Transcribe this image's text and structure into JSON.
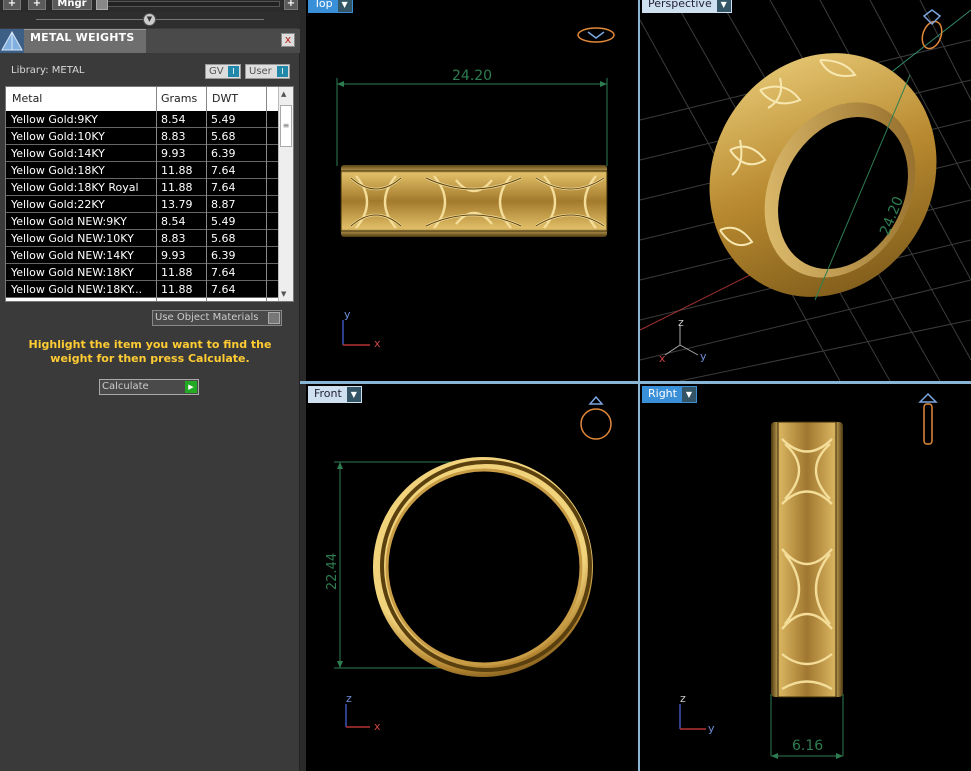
{
  "toolbar": {
    "btn_plus_1": "+",
    "btn_plus_2": "+",
    "btn_mngr": "Mngr",
    "btn_plus_3": "+"
  },
  "panel": {
    "title": "METAL WEIGHTS",
    "close": "x",
    "library_label": "Library: METAL",
    "gv_label": "GV",
    "user_label": "User",
    "columns": [
      "Metal",
      "Grams",
      "DWT"
    ],
    "rows": [
      {
        "metal": "Yellow Gold:9KY",
        "grams": "8.54",
        "dwt": "5.49"
      },
      {
        "metal": "Yellow Gold:10KY",
        "grams": "8.83",
        "dwt": "5.68"
      },
      {
        "metal": "Yellow Gold:14KY",
        "grams": "9.93",
        "dwt": "6.39"
      },
      {
        "metal": "Yellow Gold:18KY",
        "grams": "11.88",
        "dwt": "7.64"
      },
      {
        "metal": "Yellow Gold:18KY Royal",
        "grams": "11.88",
        "dwt": "7.64"
      },
      {
        "metal": "Yellow Gold:22KY",
        "grams": "13.79",
        "dwt": "8.87"
      },
      {
        "metal": "Yellow Gold NEW:9KY",
        "grams": "8.54",
        "dwt": "5.49"
      },
      {
        "metal": "Yellow Gold NEW:10KY",
        "grams": "8.83",
        "dwt": "5.68"
      },
      {
        "metal": "Yellow Gold NEW:14KY",
        "grams": "9.93",
        "dwt": "6.39"
      },
      {
        "metal": "Yellow Gold NEW:18KY",
        "grams": "11.88",
        "dwt": "7.64"
      },
      {
        "metal": "Yellow Gold NEW:18KY...",
        "grams": "11.88",
        "dwt": "7.64"
      }
    ],
    "use_object_materials": "Use Object Materials",
    "instructions": "Highlight the item you want to find the weight for then press Calculate.",
    "calculate_label": "Calculate"
  },
  "viewports": {
    "top": {
      "label": "Top",
      "dimension": "24.20",
      "axis_v": "y",
      "axis_h": "x"
    },
    "perspective": {
      "label": "Perspective",
      "dimension": "24.20",
      "axis_v": "z",
      "axis_x": "x",
      "axis_y": "y"
    },
    "front": {
      "label": "Front",
      "dimension": "22.44",
      "axis_v": "z",
      "axis_h": "x"
    },
    "right": {
      "label": "Right",
      "dimension": "6.16",
      "axis_v": "z",
      "axis_h": "y"
    }
  },
  "colors": {
    "panel_bg": "#3a3a3a",
    "accent_blue": "#3a8fd9",
    "instruction_text": "#ffcc33",
    "dimension_green": "#2e7d52",
    "gold": "#d9b256"
  },
  "icons": {
    "app_logo": "pyramid-logo-icon",
    "close": "close-icon",
    "dropdown": "chevron-down-icon",
    "calculate_go": "play-arrow-icon",
    "view_ring_top": "ring-top-view-icon",
    "view_ring_persp": "ring-perspective-icon",
    "view_ring_front": "ring-front-view-icon",
    "view_ring_side": "ring-side-view-icon"
  }
}
